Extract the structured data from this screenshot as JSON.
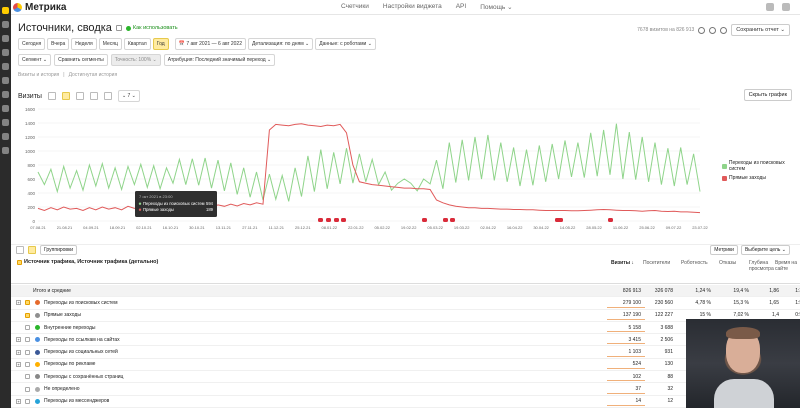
{
  "app": {
    "name": "Метрика"
  },
  "topnav": [
    "Счетчики",
    "Настройки виджета",
    "API",
    "Помощь ⌄"
  ],
  "title": "Источники, сводка",
  "in_use_label": "Как использовать",
  "visits_count_note": "7678 визитов на 826 913",
  "save_report": "Сохранить отчет ⌄",
  "periods": [
    "Сегодня",
    "Вчера",
    "Неделя",
    "Месяц",
    "Квартал",
    "Год"
  ],
  "selected_period": "Год",
  "date_range": "7 авг 2021 — 6 авг 2022",
  "detail": "Детализация: по дням ⌄",
  "data_mode": "Данные: с роботами ⌄",
  "filters": [
    "Сегмент ⌄",
    "Сравнить сегменты",
    "Точность: 100% ⌄",
    "Атрибуция: Последний значимый переход ⌄"
  ],
  "crumbs": [
    "Визиты и история",
    "Достигнутая история"
  ],
  "visits_label": "Визиты",
  "chart_period_select": "⌄ 7 ⌄",
  "hide_chart": "Скрыть график",
  "tooltip": {
    "head": "7 окт 2021 в 23:00",
    "rows": [
      {
        "label": "Переходы из поисковых систем",
        "value": "594"
      },
      {
        "label": "Прямые заходы",
        "value": "189"
      }
    ]
  },
  "chart_data": {
    "type": "line",
    "title": "",
    "ylabel": "",
    "xlabel": "",
    "ylim": [
      0,
      1600
    ],
    "yticks": [
      0,
      200,
      400,
      600,
      800,
      1000,
      1200,
      1400,
      1600
    ],
    "xticks": [
      "07.08.21",
      "21.08.21",
      "04.09.21",
      "18.09.21",
      "02.10.21",
      "16.10.21",
      "30.10.21",
      "13.11.21",
      "27.11.21",
      "11.12.21",
      "25.12.21",
      "08.01.22",
      "22.01.22",
      "05.02.22",
      "19.02.22",
      "05.03.22",
      "19.03.22",
      "02.04.22",
      "16.04.22",
      "30.04.22",
      "14.05.22",
      "28.05.22",
      "11.06.22",
      "25.06.22",
      "09.07.22",
      "23.07.22"
    ],
    "grid": true,
    "legend_placement": "right",
    "series": [
      {
        "name": "Переходы из поисковых систем",
        "color": "#8fd48a",
        "values": [
          700,
          520,
          740,
          420,
          780,
          470,
          720,
          440,
          800,
          500,
          820,
          470,
          760,
          450,
          780,
          520,
          810,
          480,
          790,
          460,
          760,
          540,
          880,
          520,
          890,
          510,
          900,
          470,
          870,
          430,
          830,
          380,
          760,
          340,
          700,
          300,
          670,
          310,
          650,
          280,
          760,
          350,
          930,
          420,
          1020,
          460,
          980,
          530,
          1040,
          540,
          960,
          560,
          880,
          520,
          700,
          440,
          540,
          600,
          540,
          430,
          600,
          530,
          870,
          460,
          1120,
          550,
          1160,
          580,
          1200,
          600,
          1230,
          580,
          1120,
          560,
          1050,
          500,
          1020,
          510,
          1080,
          560,
          1100,
          600,
          1150,
          630,
          1120,
          620,
          1260,
          640,
          1300,
          660,
          1390,
          600,
          1270,
          590,
          1200,
          560,
          1120,
          520,
          1040,
          500,
          1050,
          520,
          960,
          420
        ]
      },
      {
        "name": "Прямые заходы",
        "color": "#e05a5a",
        "values": [
          180,
          150,
          190,
          160,
          200,
          170,
          180,
          150,
          190,
          160,
          200,
          170,
          190,
          160,
          210,
          180,
          200,
          170,
          190,
          165,
          185,
          175,
          200,
          180,
          210,
          190,
          220,
          195,
          230,
          210,
          240,
          215,
          250,
          230,
          260,
          240,
          1300,
          1380,
          1370,
          1360,
          1380,
          1390,
          1370,
          1360,
          1350,
          1370,
          1360,
          1380,
          1260,
          800,
          560,
          540,
          520,
          510,
          500,
          490,
          480,
          470,
          470,
          460,
          460,
          450,
          300,
          260,
          230,
          210,
          200,
          190,
          190,
          180,
          180,
          175,
          170,
          170,
          165,
          165,
          160,
          160,
          155,
          150,
          150,
          150,
          150,
          145,
          145,
          150,
          155,
          160,
          165,
          160,
          155,
          150,
          150,
          145,
          140,
          145,
          150,
          140,
          135,
          140,
          130,
          130,
          125,
          120
        ]
      }
    ]
  },
  "table": {
    "toolbar": [
      "Группировки"
    ],
    "right_buttons": [
      "Метрики",
      "Выберите цель ⌄"
    ],
    "first_col_header": "Источник трафика, Источник трафика (детально)",
    "columns": [
      "Визиты ↓",
      "Посетители",
      "Роботность",
      "Отказы",
      "Глубина просмотра",
      "Время на сайте"
    ],
    "rows": [
      {
        "name": "Итого и средние",
        "total": true,
        "icon": "",
        "values": [
          "826 913",
          "326 078",
          "1,24 %",
          "19,4 %",
          "1,86",
          "1:38"
        ]
      },
      {
        "name": "Переходы из поисковых систем",
        "checked": true,
        "expand": true,
        "icon": "#e66a2c",
        "values": [
          "279 100",
          "230 560",
          "4,78 %",
          "15,3 %",
          "1,65",
          "1:58"
        ]
      },
      {
        "name": "Прямые заходы",
        "checked": true,
        "icon": "#8f8f8f",
        "values": [
          "137 190",
          "122 227",
          "15 %",
          "7,02 %",
          "1,4",
          "0:55"
        ]
      },
      {
        "name": "Внутренние переходы",
        "icon": "#2bb52b",
        "values": [
          "5 158",
          "3 688",
          "",
          "",
          "",
          ""
        ]
      },
      {
        "name": "Переходы по ссылкам на сайтах",
        "expand": true,
        "icon": "#4a90e2",
        "values": [
          "3 415",
          "2 506",
          "",
          "",
          "",
          ""
        ]
      },
      {
        "name": "Переходы из социальных сетей",
        "expand": true,
        "icon": "#3b5998",
        "values": [
          "1 103",
          "931",
          "",
          "",
          "",
          ""
        ]
      },
      {
        "name": "Переходы по рекламе",
        "expand": true,
        "icon": "#ffb000",
        "values": [
          "524",
          "130",
          "",
          "",
          "",
          ""
        ]
      },
      {
        "name": "Переходы с сохранённых страниц",
        "icon": "#888888",
        "values": [
          "102",
          "88",
          "",
          "",
          "",
          ""
        ]
      },
      {
        "name": "Не определено",
        "icon": "#aaaaaa",
        "values": [
          "37",
          "32",
          "",
          "",
          "",
          ""
        ]
      },
      {
        "name": "Переходы из мессенджеров",
        "expand": true,
        "icon": "#26a3d9",
        "values": [
          "14",
          "12",
          "",
          "",
          "",
          ""
        ]
      }
    ]
  }
}
